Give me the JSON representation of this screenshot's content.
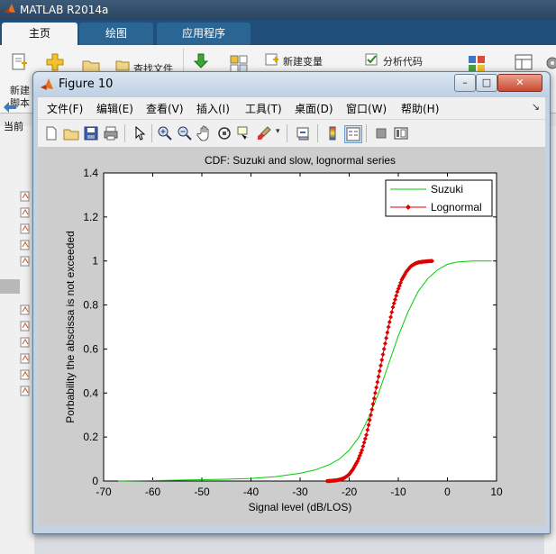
{
  "matlab": {
    "title": "MATLAB R2014a",
    "tabs": [
      "主页",
      "绘图",
      "应用程序"
    ],
    "ribbon": {
      "new_script_top": "新建",
      "new_script_bottom": "脚本",
      "find_files": "查找文件",
      "new_variable": "新建变量",
      "analyze_code": "分析代码"
    },
    "current_folder_label": "当前"
  },
  "figure": {
    "title": "Figure 10",
    "window_buttons": {
      "minimize": "–",
      "maximize": "□",
      "close": "✕"
    },
    "menu": [
      "文件(F)",
      "编辑(E)",
      "查看(V)",
      "插入(I)",
      "工具(T)",
      "桌面(D)",
      "窗口(W)",
      "帮助(H)"
    ],
    "toolbar_icons": [
      "new-figure-icon",
      "open-file-icon",
      "save-icon",
      "print-icon",
      "edit-plot-arrow-icon",
      "zoom-in-icon",
      "zoom-out-icon",
      "pan-hand-icon",
      "rotate-3d-icon",
      "data-cursor-icon",
      "brush-icon",
      "link-plot-icon",
      "colorbar-icon",
      "legend-icon",
      "hide-plot-tools-icon",
      "show-plot-tools-icon"
    ]
  },
  "chart_data": {
    "type": "line",
    "title": "CDF: Suzuki and slow, lognormal series",
    "xlabel": "Signal level (dB/LOS)",
    "ylabel": "Porbability the abscissa is not exceeded",
    "xlim": [
      -70,
      10
    ],
    "ylim": [
      0,
      1.4
    ],
    "xticks": [
      -70,
      -60,
      -50,
      -40,
      -30,
      -20,
      -10,
      0,
      10
    ],
    "yticks": [
      0,
      0.2,
      0.4,
      0.6,
      0.8,
      1,
      1.2,
      1.4
    ],
    "legend_position": "top-right",
    "grid": false,
    "series": [
      {
        "name": "Suzuki",
        "color": "#00cc00",
        "marker": "none",
        "x": [
          -67,
          -60,
          -50,
          -45,
          -40,
          -35,
          -30,
          -27,
          -24,
          -22,
          -20,
          -18,
          -16,
          -14,
          -12,
          -10,
          -8,
          -6,
          -4,
          -2,
          0,
          2,
          5,
          9
        ],
        "y": [
          0.0,
          0.002,
          0.006,
          0.008,
          0.012,
          0.02,
          0.035,
          0.05,
          0.075,
          0.1,
          0.14,
          0.2,
          0.29,
          0.4,
          0.53,
          0.66,
          0.77,
          0.86,
          0.92,
          0.96,
          0.985,
          0.995,
          1.0,
          1.0
        ]
      },
      {
        "name": "Lognormal",
        "color": "#dd0000",
        "marker": "diamond",
        "x": [
          -24.5,
          -23.6,
          -22.7,
          -21.8,
          -20.9,
          -20.0,
          -19.2,
          -18.3,
          -17.4,
          -16.5,
          -15.6,
          -14.7,
          -13.8,
          -12.9,
          -12.0,
          -11.1,
          -10.2,
          -9.3,
          -8.4,
          -7.5,
          -6.6,
          -5.8,
          -4.9,
          -4.0,
          -3.1
        ],
        "y": [
          0.0,
          0.001,
          0.003,
          0.007,
          0.015,
          0.03,
          0.055,
          0.09,
          0.14,
          0.21,
          0.3,
          0.4,
          0.5,
          0.6,
          0.7,
          0.79,
          0.86,
          0.915,
          0.95,
          0.975,
          0.988,
          0.994,
          0.997,
          0.999,
          1.0
        ]
      }
    ]
  }
}
